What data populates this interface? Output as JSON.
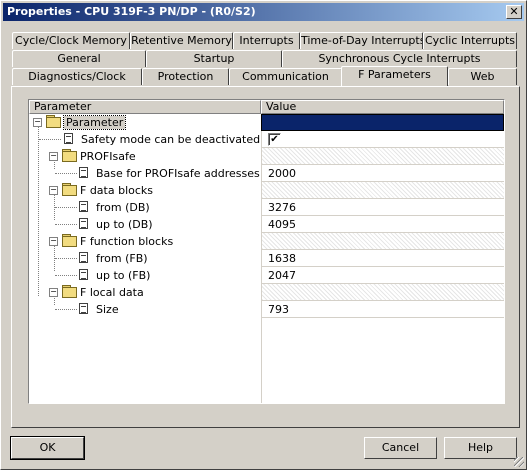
{
  "window": {
    "title": "Properties - CPU 319F-3 PN/DP - (R0/S2)"
  },
  "tabs": {
    "row1": [
      "Cycle/Clock Memory",
      "Retentive Memory",
      "Interrupts",
      "Time-of-Day Interrupts",
      "Cyclic Interrupts"
    ],
    "row2": [
      "General",
      "Startup",
      "Synchronous Cycle Interrupts"
    ],
    "row3": [
      "Diagnostics/Clock",
      "Protection",
      "Communication",
      "F Parameters",
      "Web"
    ],
    "active": "F Parameters"
  },
  "grid": {
    "columns": [
      "Parameter",
      "Value"
    ],
    "rows": [
      {
        "label": "Parameter",
        "value": "",
        "kind": "root"
      },
      {
        "label": "Safety mode can be deactivated",
        "value": "✔",
        "kind": "checkbox"
      },
      {
        "label": "PROFIsafe",
        "value": "",
        "kind": "folder"
      },
      {
        "label": "Base for PROFIsafe addresses",
        "value": "2000",
        "kind": "leaf"
      },
      {
        "label": "F data blocks",
        "value": "",
        "kind": "folder"
      },
      {
        "label": "from (DB)",
        "value": "3276",
        "kind": "leaf"
      },
      {
        "label": "up to (DB)",
        "value": "4095",
        "kind": "leaf"
      },
      {
        "label": "F function blocks",
        "value": "",
        "kind": "folder"
      },
      {
        "label": "from (FB)",
        "value": "1638",
        "kind": "leaf"
      },
      {
        "label": "up to (FB)",
        "value": "2047",
        "kind": "leaf"
      },
      {
        "label": "F local data",
        "value": "",
        "kind": "folder"
      },
      {
        "label": "Size",
        "value": "793",
        "kind": "leaf"
      }
    ]
  },
  "buttons": {
    "ok": "OK",
    "cancel": "Cancel",
    "help": "Help"
  }
}
